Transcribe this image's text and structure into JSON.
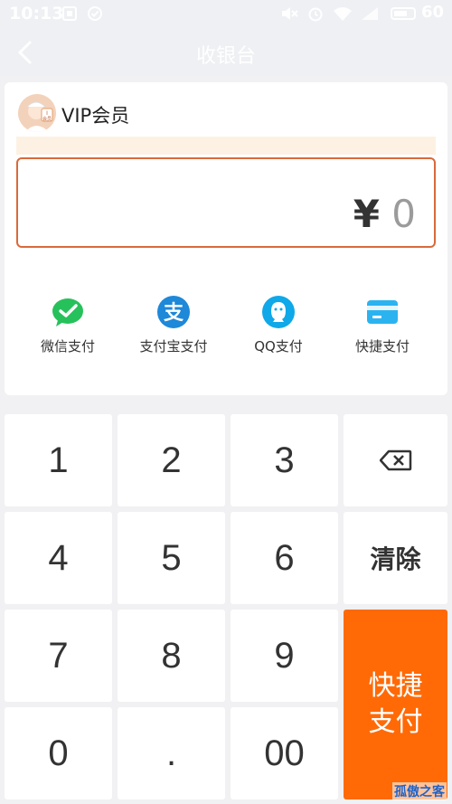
{
  "status_bar": {
    "time": "10:13",
    "battery": "60"
  },
  "header": {
    "title": "收银台"
  },
  "member": {
    "name": "VIP会员",
    "avatar_badge": "I\n会员"
  },
  "amount": {
    "currency": "¥",
    "value": "0"
  },
  "payment_methods": [
    {
      "label": "微信支付",
      "icon": "wechat-pay-icon",
      "color": "#27c15b"
    },
    {
      "label": "支付宝支付",
      "icon": "alipay-icon",
      "color": "#1e88d9"
    },
    {
      "label": "QQ支付",
      "icon": "qq-pay-icon",
      "color": "#0fa8e8"
    },
    {
      "label": "快捷支付",
      "icon": "bank-card-icon",
      "color": "#2bb3f0"
    }
  ],
  "keypad": {
    "digits": [
      "1",
      "2",
      "3",
      "4",
      "5",
      "6",
      "7",
      "8",
      "9",
      "0",
      ".",
      "00"
    ],
    "backspace_icon": "backspace-icon",
    "clear_label": "清除",
    "pay_label_line1": "快捷",
    "pay_label_line2": "支付"
  },
  "colors": {
    "accent": "#ff6a06",
    "amount_border": "#d9693b"
  },
  "watermark": "孤傲之客"
}
